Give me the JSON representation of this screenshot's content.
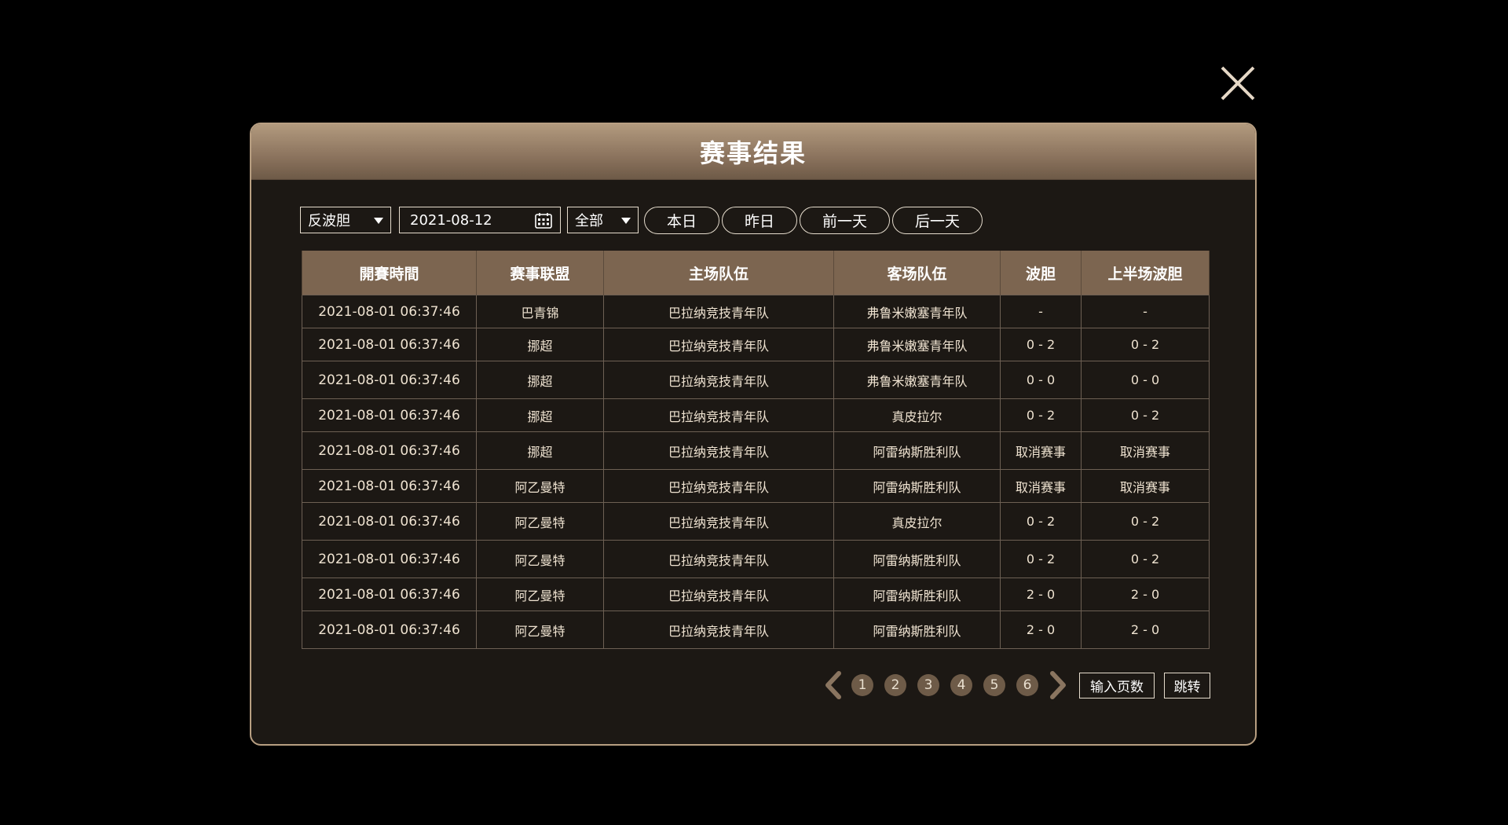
{
  "modal": {
    "title": "赛事结果"
  },
  "filters": {
    "type_value": "反波胆",
    "date_value": "2021-08-12",
    "scope_value": "全部",
    "today_label": "本日",
    "yesterday_label": "昨日",
    "prev_day_label": "前一天",
    "next_day_label": "后一天"
  },
  "table": {
    "headers": [
      "開賽時間",
      "赛事联盟",
      "主场队伍",
      "客场队伍",
      "波胆",
      "上半场波胆"
    ],
    "rows": [
      [
        "2021-08-01 06:37:46",
        "巴青锦",
        "巴拉纳竞技青年队",
        "弗鲁米嫩塞青年队",
        "-",
        "-"
      ],
      [
        "2021-08-01 06:37:46",
        "挪超",
        "巴拉纳竞技青年队",
        "弗鲁米嫩塞青年队",
        "0 - 2",
        "0 - 2"
      ],
      [
        "2021-08-01 06:37:46",
        "挪超",
        "巴拉纳竞技青年队",
        "弗鲁米嫩塞青年队",
        "0 - 0",
        "0 - 0"
      ],
      [
        "2021-08-01 06:37:46",
        "挪超",
        "巴拉纳竞技青年队",
        "真皮拉尔",
        "0 - 2",
        "0 - 2"
      ],
      [
        "2021-08-01 06:37:46",
        "挪超",
        "巴拉纳竞技青年队",
        "阿雷纳斯胜利队",
        "取消赛事",
        "取消赛事"
      ],
      [
        "2021-08-01 06:37:46",
        "阿乙曼特",
        "巴拉纳竞技青年队",
        "阿雷纳斯胜利队",
        "取消赛事",
        "取消赛事"
      ],
      [
        "2021-08-01 06:37:46",
        "阿乙曼特",
        "巴拉纳竞技青年队",
        "真皮拉尔",
        "0 - 2",
        "0 - 2"
      ],
      [
        "2021-08-01 06:37:46",
        "阿乙曼特",
        "巴拉纳竞技青年队",
        "阿雷纳斯胜利队",
        "0 - 2",
        "0 - 2"
      ],
      [
        "2021-08-01 06:37:46",
        "阿乙曼特",
        "巴拉纳竞技青年队",
        "阿雷纳斯胜利队",
        "2 - 0",
        "2 - 0"
      ],
      [
        "2021-08-01 06:37:46",
        "阿乙曼特",
        "巴拉纳竞技青年队",
        "阿雷纳斯胜利队",
        "2 - 0",
        "2 - 0"
      ]
    ]
  },
  "pagination": {
    "pages": [
      "1",
      "2",
      "3",
      "4",
      "5",
      "6"
    ],
    "input_placeholder": "输入页数",
    "jump_label": "跳转"
  },
  "icons": {
    "close": "close-icon",
    "calendar": "calendar-icon",
    "prev": "chevron-left-icon",
    "next": "chevron-right-icon"
  },
  "colors": {
    "header_gradient_top": "#b29a7e",
    "table_header": "#7c6550",
    "page_bubble": "#6e5b48",
    "background": "#1c1814"
  }
}
